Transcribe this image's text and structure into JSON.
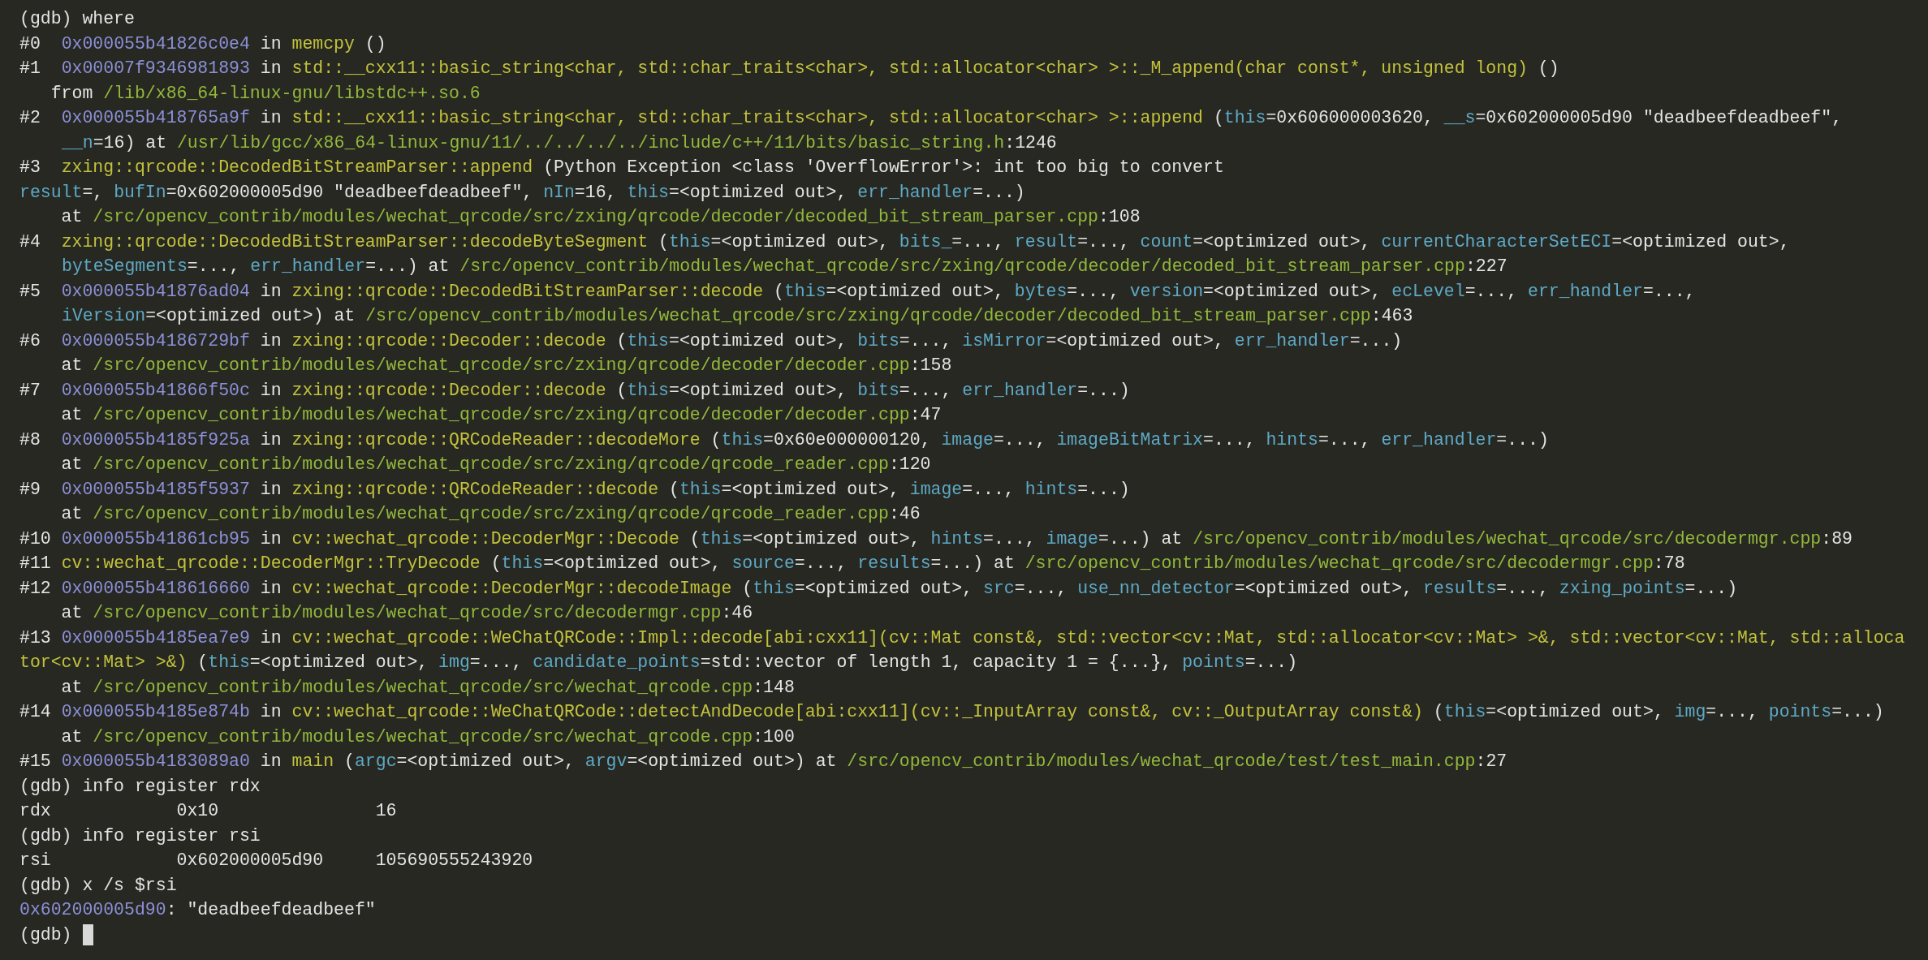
{
  "terminal": {
    "lines": [
      {
        "segments": [
          {
            "kind": "text",
            "text": "(gdb) where"
          }
        ]
      },
      {
        "segments": [
          {
            "kind": "text",
            "text": "#0  "
          },
          {
            "kind": "address",
            "text": "0x000055b41826c0e4"
          },
          {
            "kind": "text",
            "text": " in "
          },
          {
            "kind": "function",
            "text": "memcpy"
          },
          {
            "kind": "text",
            "text": " ()"
          }
        ]
      },
      {
        "segments": [
          {
            "kind": "text",
            "text": "#1  "
          },
          {
            "kind": "address",
            "text": "0x00007f9346981893"
          },
          {
            "kind": "text",
            "text": " in "
          },
          {
            "kind": "function",
            "text": "std::__cxx11::basic_string<char, std::char_traits<char>, std::allocator<char> >::_M_append(char const*, unsigned long)"
          },
          {
            "kind": "text",
            "text": " ()"
          }
        ]
      },
      {
        "segments": [
          {
            "kind": "text",
            "text": "   from "
          },
          {
            "kind": "path",
            "text": "/lib/x86_64-linux-gnu/libstdc++.so.6"
          }
        ]
      },
      {
        "segments": [
          {
            "kind": "text",
            "text": "#2  "
          },
          {
            "kind": "address",
            "text": "0x000055b418765a9f"
          },
          {
            "kind": "text",
            "text": " in "
          },
          {
            "kind": "function",
            "text": "std::__cxx11::basic_string<char, std::char_traits<char>, std::allocator<char> >::append"
          },
          {
            "kind": "text",
            "text": " ("
          },
          {
            "kind": "param",
            "text": "this"
          },
          {
            "kind": "text",
            "text": "=0x606000003620, "
          },
          {
            "kind": "param",
            "text": "__s"
          },
          {
            "kind": "text",
            "text": "=0x602000005d90 \"deadbeefdeadbeef\","
          }
        ]
      },
      {
        "indented": true,
        "segments": [
          {
            "kind": "param",
            "text": "__n"
          },
          {
            "kind": "text",
            "text": "=16) at "
          },
          {
            "kind": "path",
            "text": "/usr/lib/gcc/x86_64-linux-gnu/11/../../../../include/c++/11/bits/basic_string.h"
          },
          {
            "kind": "text",
            "text": ":1246"
          }
        ]
      },
      {
        "segments": [
          {
            "kind": "text",
            "text": "#3  "
          },
          {
            "kind": "function",
            "text": "zxing::qrcode::DecodedBitStreamParser::append"
          },
          {
            "kind": "text",
            "text": " (Python Exception <class 'OverflowError'>: int too big to convert"
          }
        ]
      },
      {
        "segments": [
          {
            "kind": "param",
            "text": "result"
          },
          {
            "kind": "text",
            "text": "=, "
          },
          {
            "kind": "param",
            "text": "bufIn"
          },
          {
            "kind": "text",
            "text": "=0x602000005d90 \"deadbeefdeadbeef\", "
          },
          {
            "kind": "param",
            "text": "nIn"
          },
          {
            "kind": "text",
            "text": "=16, "
          },
          {
            "kind": "param",
            "text": "this"
          },
          {
            "kind": "text",
            "text": "=<optimized out>, "
          },
          {
            "kind": "param",
            "text": "err_handler"
          },
          {
            "kind": "text",
            "text": "=...)"
          }
        ]
      },
      {
        "segments": [
          {
            "kind": "text",
            "text": "    at "
          },
          {
            "kind": "path",
            "text": "/src/opencv_contrib/modules/wechat_qrcode/src/zxing/qrcode/decoder/decoded_bit_stream_parser.cpp"
          },
          {
            "kind": "text",
            "text": ":108"
          }
        ]
      },
      {
        "segments": [
          {
            "kind": "text",
            "text": "#4  "
          },
          {
            "kind": "function",
            "text": "zxing::qrcode::DecodedBitStreamParser::decodeByteSegment"
          },
          {
            "kind": "text",
            "text": " ("
          },
          {
            "kind": "param",
            "text": "this"
          },
          {
            "kind": "text",
            "text": "=<optimized out>, "
          },
          {
            "kind": "param",
            "text": "bits_"
          },
          {
            "kind": "text",
            "text": "=..., "
          },
          {
            "kind": "param",
            "text": "result"
          },
          {
            "kind": "text",
            "text": "=..., "
          },
          {
            "kind": "param",
            "text": "count"
          },
          {
            "kind": "text",
            "text": "=<optimized out>, "
          },
          {
            "kind": "param",
            "text": "currentCharacterSetECI"
          },
          {
            "kind": "text",
            "text": "=<optimized out>,"
          }
        ]
      },
      {
        "indented": true,
        "segments": [
          {
            "kind": "param",
            "text": "byteSegments"
          },
          {
            "kind": "text",
            "text": "=..., "
          },
          {
            "kind": "param",
            "text": "err_handler"
          },
          {
            "kind": "text",
            "text": "=...) at "
          },
          {
            "kind": "path",
            "text": "/src/opencv_contrib/modules/wechat_qrcode/src/zxing/qrcode/decoder/decoded_bit_stream_parser.cpp"
          },
          {
            "kind": "text",
            "text": ":227"
          }
        ]
      },
      {
        "segments": [
          {
            "kind": "text",
            "text": "#5  "
          },
          {
            "kind": "address",
            "text": "0x000055b41876ad04"
          },
          {
            "kind": "text",
            "text": " in "
          },
          {
            "kind": "function",
            "text": "zxing::qrcode::DecodedBitStreamParser::decode"
          },
          {
            "kind": "text",
            "text": " ("
          },
          {
            "kind": "param",
            "text": "this"
          },
          {
            "kind": "text",
            "text": "=<optimized out>, "
          },
          {
            "kind": "param",
            "text": "bytes"
          },
          {
            "kind": "text",
            "text": "=..., "
          },
          {
            "kind": "param",
            "text": "version"
          },
          {
            "kind": "text",
            "text": "=<optimized out>, "
          },
          {
            "kind": "param",
            "text": "ecLevel"
          },
          {
            "kind": "text",
            "text": "=..., "
          },
          {
            "kind": "param",
            "text": "err_handler"
          },
          {
            "kind": "text",
            "text": "=...,"
          }
        ]
      },
      {
        "indented": true,
        "segments": [
          {
            "kind": "param",
            "text": "iVersion"
          },
          {
            "kind": "text",
            "text": "=<optimized out>) at "
          },
          {
            "kind": "path",
            "text": "/src/opencv_contrib/modules/wechat_qrcode/src/zxing/qrcode/decoder/decoded_bit_stream_parser.cpp"
          },
          {
            "kind": "text",
            "text": ":463"
          }
        ]
      },
      {
        "segments": [
          {
            "kind": "text",
            "text": "#6  "
          },
          {
            "kind": "address",
            "text": "0x000055b4186729bf"
          },
          {
            "kind": "text",
            "text": " in "
          },
          {
            "kind": "function",
            "text": "zxing::qrcode::Decoder::decode"
          },
          {
            "kind": "text",
            "text": " ("
          },
          {
            "kind": "param",
            "text": "this"
          },
          {
            "kind": "text",
            "text": "=<optimized out>, "
          },
          {
            "kind": "param",
            "text": "bits"
          },
          {
            "kind": "text",
            "text": "=..., "
          },
          {
            "kind": "param",
            "text": "isMirror"
          },
          {
            "kind": "text",
            "text": "=<optimized out>, "
          },
          {
            "kind": "param",
            "text": "err_handler"
          },
          {
            "kind": "text",
            "text": "=...)"
          }
        ]
      },
      {
        "segments": [
          {
            "kind": "text",
            "text": "    at "
          },
          {
            "kind": "path",
            "text": "/src/opencv_contrib/modules/wechat_qrcode/src/zxing/qrcode/decoder/decoder.cpp"
          },
          {
            "kind": "text",
            "text": ":158"
          }
        ]
      },
      {
        "segments": [
          {
            "kind": "text",
            "text": "#7  "
          },
          {
            "kind": "address",
            "text": "0x000055b41866f50c"
          },
          {
            "kind": "text",
            "text": " in "
          },
          {
            "kind": "function",
            "text": "zxing::qrcode::Decoder::decode"
          },
          {
            "kind": "text",
            "text": " ("
          },
          {
            "kind": "param",
            "text": "this"
          },
          {
            "kind": "text",
            "text": "=<optimized out>, "
          },
          {
            "kind": "param",
            "text": "bits"
          },
          {
            "kind": "text",
            "text": "=..., "
          },
          {
            "kind": "param",
            "text": "err_handler"
          },
          {
            "kind": "text",
            "text": "=...)"
          }
        ]
      },
      {
        "segments": [
          {
            "kind": "text",
            "text": "    at "
          },
          {
            "kind": "path",
            "text": "/src/opencv_contrib/modules/wechat_qrcode/src/zxing/qrcode/decoder/decoder.cpp"
          },
          {
            "kind": "text",
            "text": ":47"
          }
        ]
      },
      {
        "segments": [
          {
            "kind": "text",
            "text": "#8  "
          },
          {
            "kind": "address",
            "text": "0x000055b4185f925a"
          },
          {
            "kind": "text",
            "text": " in "
          },
          {
            "kind": "function",
            "text": "zxing::qrcode::QRCodeReader::decodeMore"
          },
          {
            "kind": "text",
            "text": " ("
          },
          {
            "kind": "param",
            "text": "this"
          },
          {
            "kind": "text",
            "text": "=0x60e000000120, "
          },
          {
            "kind": "param",
            "text": "image"
          },
          {
            "kind": "text",
            "text": "=..., "
          },
          {
            "kind": "param",
            "text": "imageBitMatrix"
          },
          {
            "kind": "text",
            "text": "=..., "
          },
          {
            "kind": "param",
            "text": "hints"
          },
          {
            "kind": "text",
            "text": "=..., "
          },
          {
            "kind": "param",
            "text": "err_handler"
          },
          {
            "kind": "text",
            "text": "=...)"
          }
        ]
      },
      {
        "segments": [
          {
            "kind": "text",
            "text": "    at "
          },
          {
            "kind": "path",
            "text": "/src/opencv_contrib/modules/wechat_qrcode/src/zxing/qrcode/qrcode_reader.cpp"
          },
          {
            "kind": "text",
            "text": ":120"
          }
        ]
      },
      {
        "segments": [
          {
            "kind": "text",
            "text": "#9  "
          },
          {
            "kind": "address",
            "text": "0x000055b4185f5937"
          },
          {
            "kind": "text",
            "text": " in "
          },
          {
            "kind": "function",
            "text": "zxing::qrcode::QRCodeReader::decode"
          },
          {
            "kind": "text",
            "text": " ("
          },
          {
            "kind": "param",
            "text": "this"
          },
          {
            "kind": "text",
            "text": "=<optimized out>, "
          },
          {
            "kind": "param",
            "text": "image"
          },
          {
            "kind": "text",
            "text": "=..., "
          },
          {
            "kind": "param",
            "text": "hints"
          },
          {
            "kind": "text",
            "text": "=...)"
          }
        ]
      },
      {
        "segments": [
          {
            "kind": "text",
            "text": "    at "
          },
          {
            "kind": "path",
            "text": "/src/opencv_contrib/modules/wechat_qrcode/src/zxing/qrcode/qrcode_reader.cpp"
          },
          {
            "kind": "text",
            "text": ":46"
          }
        ]
      },
      {
        "segments": [
          {
            "kind": "text",
            "text": "#10 "
          },
          {
            "kind": "address",
            "text": "0x000055b41861cb95"
          },
          {
            "kind": "text",
            "text": " in "
          },
          {
            "kind": "function",
            "text": "cv::wechat_qrcode::DecoderMgr::Decode"
          },
          {
            "kind": "text",
            "text": " ("
          },
          {
            "kind": "param",
            "text": "this"
          },
          {
            "kind": "text",
            "text": "=<optimized out>, "
          },
          {
            "kind": "param",
            "text": "hints"
          },
          {
            "kind": "text",
            "text": "=..., "
          },
          {
            "kind": "param",
            "text": "image"
          },
          {
            "kind": "text",
            "text": "=...) at "
          },
          {
            "kind": "path",
            "text": "/src/opencv_contrib/modules/wechat_qrcode/src/decodermgr.cpp"
          },
          {
            "kind": "text",
            "text": ":89"
          }
        ]
      },
      {
        "segments": [
          {
            "kind": "text",
            "text": "#11 "
          },
          {
            "kind": "function",
            "text": "cv::wechat_qrcode::DecoderMgr::TryDecode"
          },
          {
            "kind": "text",
            "text": " ("
          },
          {
            "kind": "param",
            "text": "this"
          },
          {
            "kind": "text",
            "text": "=<optimized out>, "
          },
          {
            "kind": "param",
            "text": "source"
          },
          {
            "kind": "text",
            "text": "=..., "
          },
          {
            "kind": "param",
            "text": "results"
          },
          {
            "kind": "text",
            "text": "=...) at "
          },
          {
            "kind": "path",
            "text": "/src/opencv_contrib/modules/wechat_qrcode/src/decodermgr.cpp"
          },
          {
            "kind": "text",
            "text": ":78"
          }
        ]
      },
      {
        "segments": [
          {
            "kind": "text",
            "text": "#12 "
          },
          {
            "kind": "address",
            "text": "0x000055b418616660"
          },
          {
            "kind": "text",
            "text": " in "
          },
          {
            "kind": "function",
            "text": "cv::wechat_qrcode::DecoderMgr::decodeImage"
          },
          {
            "kind": "text",
            "text": " ("
          },
          {
            "kind": "param",
            "text": "this"
          },
          {
            "kind": "text",
            "text": "=<optimized out>, "
          },
          {
            "kind": "param",
            "text": "src"
          },
          {
            "kind": "text",
            "text": "=..., "
          },
          {
            "kind": "param",
            "text": "use_nn_detector"
          },
          {
            "kind": "text",
            "text": "=<optimized out>, "
          },
          {
            "kind": "param",
            "text": "results"
          },
          {
            "kind": "text",
            "text": "=..., "
          },
          {
            "kind": "param",
            "text": "zxing_points"
          },
          {
            "kind": "text",
            "text": "=...)"
          }
        ]
      },
      {
        "segments": [
          {
            "kind": "text",
            "text": "    at "
          },
          {
            "kind": "path",
            "text": "/src/opencv_contrib/modules/wechat_qrcode/src/decodermgr.cpp"
          },
          {
            "kind": "text",
            "text": ":46"
          }
        ]
      },
      {
        "segments": [
          {
            "kind": "text",
            "text": "#13 "
          },
          {
            "kind": "address",
            "text": "0x000055b4185ea7e9"
          },
          {
            "kind": "text",
            "text": " in "
          },
          {
            "kind": "function",
            "text": "cv::wechat_qrcode::WeChatQRCode::Impl::decode[abi:cxx11](cv::Mat const&, std::vector<cv::Mat, std::allocator<cv::Mat> >&, std::vector<cv::Mat, std::alloca"
          }
        ]
      },
      {
        "segments": [
          {
            "kind": "function",
            "text": "tor<cv::Mat> >&)"
          },
          {
            "kind": "text",
            "text": " ("
          },
          {
            "kind": "param",
            "text": "this"
          },
          {
            "kind": "text",
            "text": "=<optimized out>, "
          },
          {
            "kind": "param",
            "text": "img"
          },
          {
            "kind": "text",
            "text": "=..., "
          },
          {
            "kind": "param",
            "text": "candidate_points"
          },
          {
            "kind": "text",
            "text": "=std::vector of length 1, capacity 1 = {...}, "
          },
          {
            "kind": "param",
            "text": "points"
          },
          {
            "kind": "text",
            "text": "=...)"
          }
        ]
      },
      {
        "segments": [
          {
            "kind": "text",
            "text": "    at "
          },
          {
            "kind": "path",
            "text": "/src/opencv_contrib/modules/wechat_qrcode/src/wechat_qrcode.cpp"
          },
          {
            "kind": "text",
            "text": ":148"
          }
        ]
      },
      {
        "segments": [
          {
            "kind": "text",
            "text": "#14 "
          },
          {
            "kind": "address",
            "text": "0x000055b4185e874b"
          },
          {
            "kind": "text",
            "text": " in "
          },
          {
            "kind": "function",
            "text": "cv::wechat_qrcode::WeChatQRCode::detectAndDecode[abi:cxx11](cv::_InputArray const&, cv::_OutputArray const&)"
          },
          {
            "kind": "text",
            "text": " ("
          },
          {
            "kind": "param",
            "text": "this"
          },
          {
            "kind": "text",
            "text": "=<optimized out>, "
          },
          {
            "kind": "param",
            "text": "img"
          },
          {
            "kind": "text",
            "text": "=..., "
          },
          {
            "kind": "param",
            "text": "points"
          },
          {
            "kind": "text",
            "text": "=...)"
          }
        ]
      },
      {
        "segments": [
          {
            "kind": "text",
            "text": "    at "
          },
          {
            "kind": "path",
            "text": "/src/opencv_contrib/modules/wechat_qrcode/src/wechat_qrcode.cpp"
          },
          {
            "kind": "text",
            "text": ":100"
          }
        ]
      },
      {
        "segments": [
          {
            "kind": "text",
            "text": "#15 "
          },
          {
            "kind": "address",
            "text": "0x000055b4183089a0"
          },
          {
            "kind": "text",
            "text": " in "
          },
          {
            "kind": "function",
            "text": "main"
          },
          {
            "kind": "text",
            "text": " ("
          },
          {
            "kind": "param",
            "text": "argc"
          },
          {
            "kind": "text",
            "text": "=<optimized out>, "
          },
          {
            "kind": "param",
            "text": "argv"
          },
          {
            "kind": "text",
            "text": "=<optimized out>) at "
          },
          {
            "kind": "path",
            "text": "/src/opencv_contrib/modules/wechat_qrcode/test/test_main.cpp"
          },
          {
            "kind": "text",
            "text": ":27"
          }
        ]
      },
      {
        "segments": [
          {
            "kind": "text",
            "text": "(gdb) info register rdx"
          }
        ]
      },
      {
        "segments": [
          {
            "kind": "text",
            "text": "rdx            0x10               16"
          }
        ]
      },
      {
        "segments": [
          {
            "kind": "text",
            "text": "(gdb) info register rsi"
          }
        ]
      },
      {
        "segments": [
          {
            "kind": "text",
            "text": "rsi            0x602000005d90     105690555243920"
          }
        ]
      },
      {
        "segments": [
          {
            "kind": "text",
            "text": "(gdb) x /s $rsi"
          }
        ]
      },
      {
        "segments": [
          {
            "kind": "address",
            "text": "0x602000005d90"
          },
          {
            "kind": "text",
            "text": ": \"deadbeefdeadbeef\""
          }
        ]
      },
      {
        "segments": [
          {
            "kind": "text",
            "text": "(gdb)"
          }
        ],
        "cursor": true
      }
    ]
  }
}
